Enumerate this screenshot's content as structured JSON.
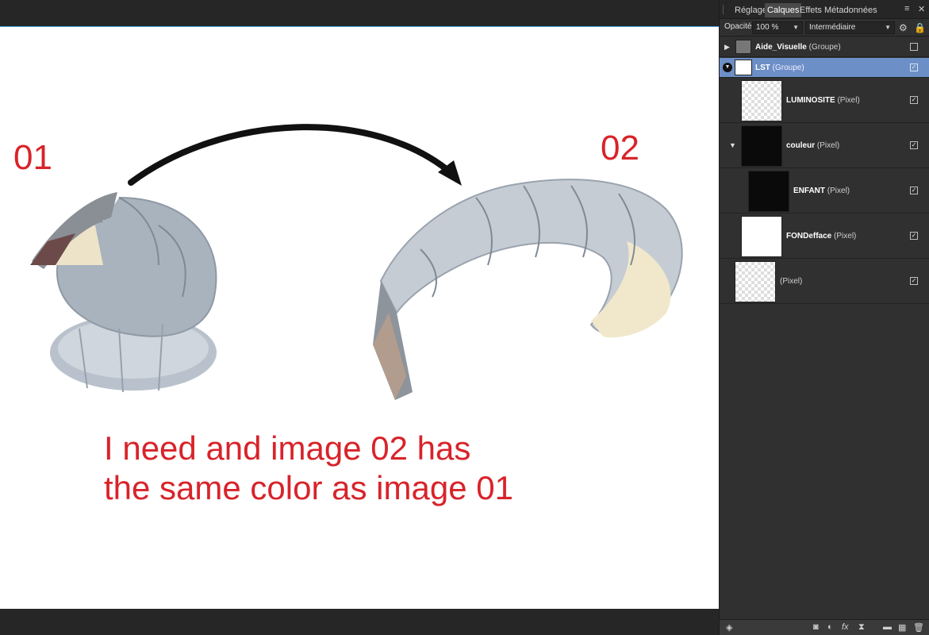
{
  "canvas": {
    "label_left": "01",
    "label_right": "02",
    "caption_line1": "I need and image 02 has",
    "caption_line2": "the same color as image 01",
    "accent_text_color": "#d8232a",
    "selection_border_color": "#4aa3df"
  },
  "panel": {
    "tabs": [
      {
        "label": "Réglage",
        "active": false
      },
      {
        "label": "Calques",
        "active": true
      },
      {
        "label": "Effets",
        "active": false
      },
      {
        "label": "Métadonnées",
        "active": false
      }
    ],
    "menu_icon": "menu-icon",
    "close_icon": "close-icon",
    "opacity_label": "Opacité:",
    "opacity_value": "100 %",
    "blend_mode": "Intermédiaire",
    "layers": [
      {
        "name": "Aide_Visuelle",
        "type": "(Groupe)",
        "checked": false,
        "expander": "▶"
      },
      {
        "name": "LST",
        "type": "(Groupe)",
        "checked": true,
        "expander": "▼",
        "selected": true
      },
      {
        "name": "LUMINOSITE",
        "type": "(Pixel)",
        "checked": true
      },
      {
        "name": "couleur",
        "type": "(Pixel)",
        "checked": true,
        "expander": "▼"
      },
      {
        "name": "ENFANT",
        "type": "(Pixel)",
        "checked": true
      },
      {
        "name": "FONDefface",
        "type": "(Pixel)",
        "checked": true
      },
      {
        "name": "",
        "type": "(Pixel)",
        "checked": true
      }
    ],
    "selected_color": "#6d8fc7"
  }
}
